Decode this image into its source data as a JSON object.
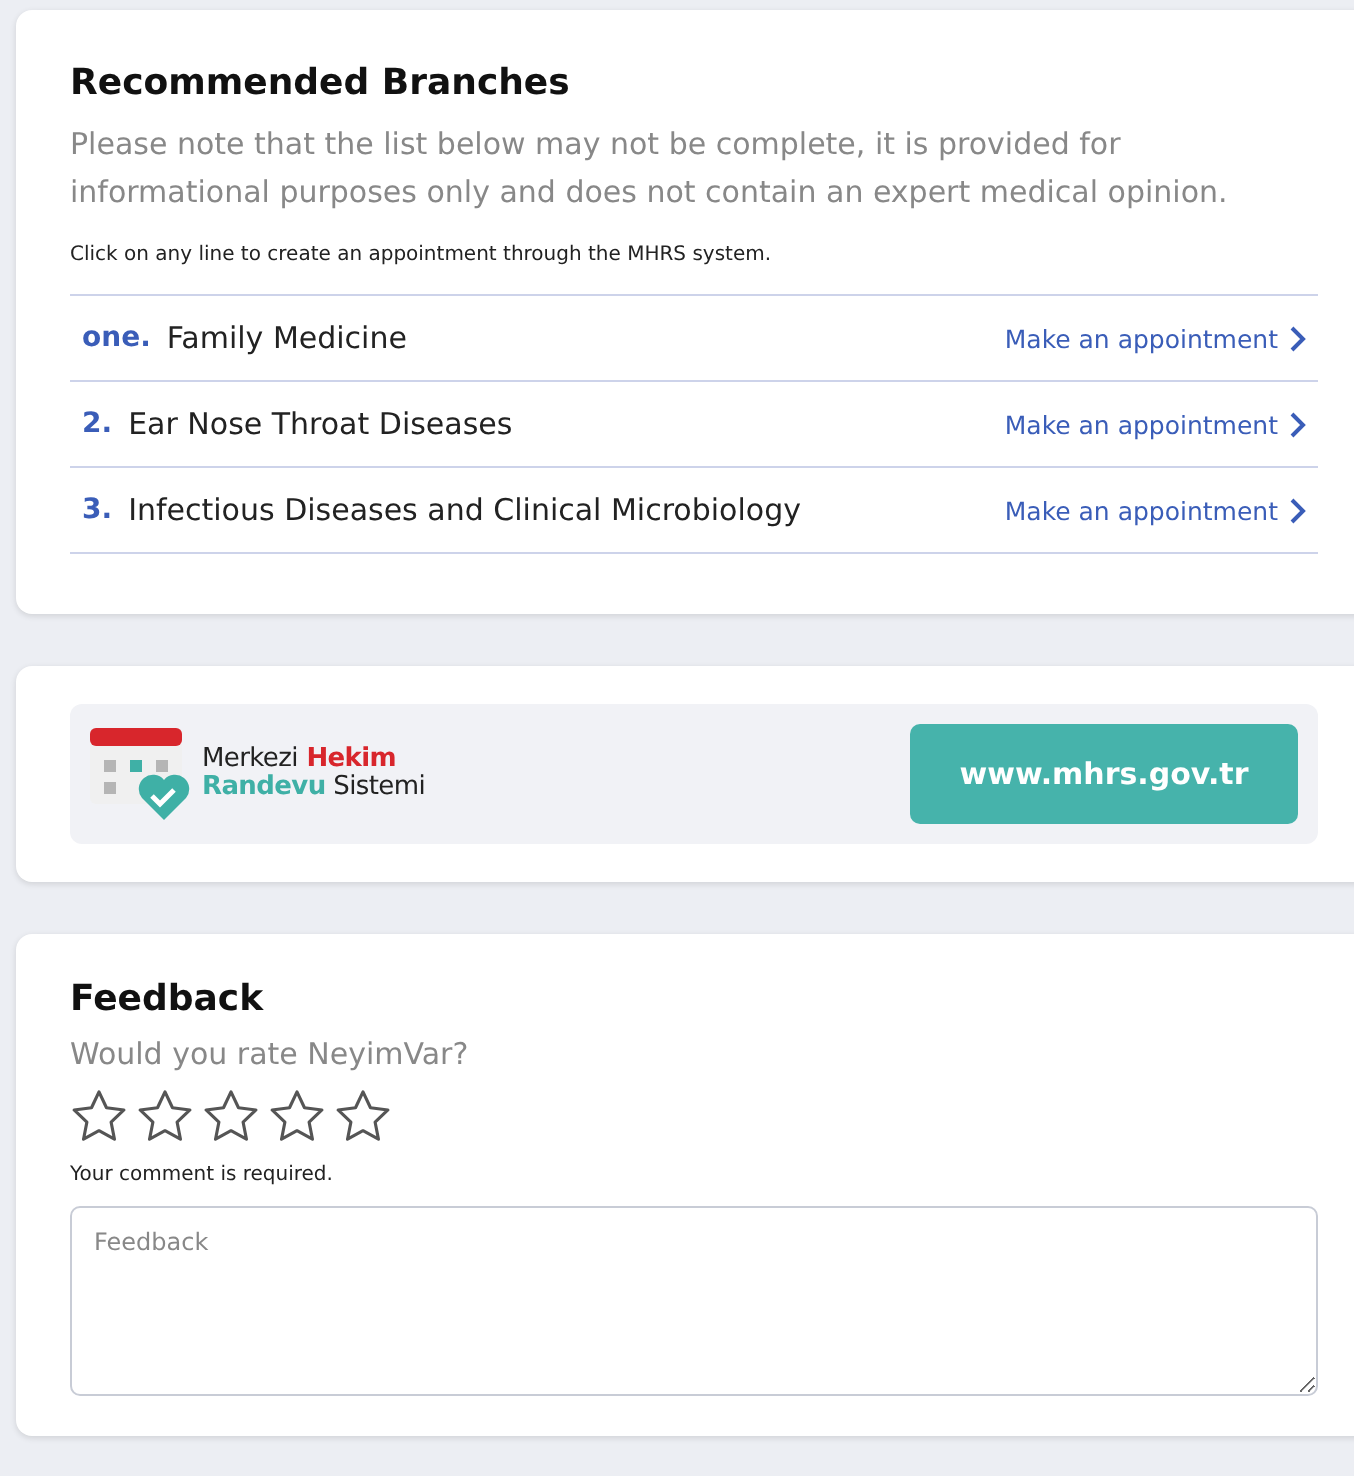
{
  "branches": {
    "title": "Recommended Branches",
    "note": "Please note that the list below may not be complete, it is provided for informational purposes only and does not contain an expert medical opinion.",
    "hint": "Click on any line to create an appointment through the MHRS system.",
    "items": [
      {
        "number": "one.",
        "name": "Family Medicine",
        "action": "Make an appointment"
      },
      {
        "number": "2.",
        "name": "Ear Nose Throat Diseases",
        "action": "Make an appointment"
      },
      {
        "number": "3.",
        "name": "Infectious Diseases and Clinical Microbiology",
        "action": "Make an appointment"
      }
    ]
  },
  "mhrs": {
    "logo_lines": [
      [
        {
          "text": "Merkezi",
          "color": "#222222"
        },
        {
          "text": "Hekim",
          "color": "#d8262c"
        }
      ],
      [
        {
          "text": "Randevu",
          "color": "#3fb0a6"
        },
        {
          "text": "Sistemi",
          "color": "#222222"
        }
      ]
    ],
    "button": "www.mhrs.gov.tr"
  },
  "feedback": {
    "title": "Feedback",
    "question": "Would you rate NeyimVar?",
    "rating": {
      "stars": 0
    },
    "required": "Your comment is required.",
    "comment": {
      "placeholder": "Feedback"
    }
  }
}
